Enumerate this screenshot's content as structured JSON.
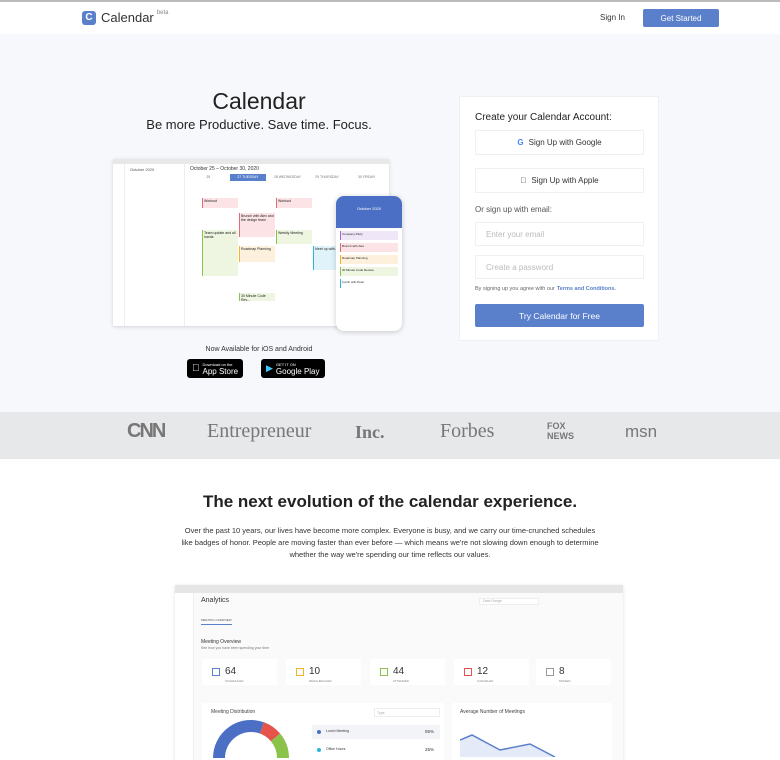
{
  "header": {
    "logo": "Calendar",
    "beta": "beta",
    "sign_in": "Sign In",
    "get_started": "Get Started"
  },
  "hero": {
    "title": "Calendar",
    "subtitle": "Be more Productive. Save time. Focus."
  },
  "mockup": {
    "range": "October 25 – October 30, 2020",
    "month": "October 2020",
    "tabs": [
      "25",
      "27 TUESDAY",
      "28 WEDNESDAY",
      "29 THURSDAY",
      "30 FRIDAY"
    ],
    "events": [
      "Workout",
      "Brunch with Alex and the design team",
      "Team update and all hands",
      "Weekly Meeting",
      "Roadmap Planning",
      "Meet up with...",
      "30 Minute Code Rev..."
    ],
    "phone_items": [
      "Company Party",
      "Brunch with Alex",
      "Roadmap Planning",
      "30 Minute Code Review",
      "Lunch with Peter"
    ]
  },
  "apps": {
    "available": "Now Available for iOS and Android",
    "appstore_small": "Download on the",
    "appstore": "App Store",
    "play_small": "GET IT ON",
    "play": "Google Play"
  },
  "signup": {
    "title": "Create your Calendar Account:",
    "google": "Sign Up with Google",
    "apple": "Sign Up with Apple",
    "or_email": "Or sign up with email:",
    "email_placeholder": "Enter your email",
    "password_placeholder": "Create a password",
    "terms_text": "By signing up you agree with our",
    "terms_link": "Terms and Conditions.",
    "submit": "Try Calendar for Free"
  },
  "press": [
    "CNN",
    "Entrepreneur",
    "Inc.",
    "Forbes",
    "FOX NEWS",
    "msn"
  ],
  "section": {
    "title": "The next evolution of the calendar experience.",
    "body": "Over the past 10 years, our lives have become more complex. Everyone is busy, and we carry our time-crunched schedules like badges of honor. People are moving faster than ever before — which means we're not slowing down enough to determine whether the way we're spending our time reflects our values."
  },
  "analytics": {
    "title": "Analytics",
    "tab": "MEETING OVERVIEW",
    "heading": "Meeting Overview",
    "subheading": "See how you have been spending your time",
    "date_range": "Date Range",
    "stats": [
      {
        "value": "64",
        "label": "SCHEDULED",
        "color": "#5a7fcb"
      },
      {
        "value": "10",
        "label": "RESCHEDULED",
        "color": "#f0b429"
      },
      {
        "value": "44",
        "label": "ATTENDED",
        "color": "#8bc34a"
      },
      {
        "value": "12",
        "label": "CANCELED",
        "color": "#e5534b"
      },
      {
        "value": "8",
        "label": "MISSED",
        "color": "#999999"
      }
    ],
    "distribution": "Meeting Distribution",
    "type": "Type",
    "avg": "Average Number of Meetings",
    "legend": [
      {
        "name": "Lunch Meeting",
        "pct": "55%",
        "color": "#4a6fc4"
      },
      {
        "name": "Office Hours",
        "pct": "25%",
        "color": "#29b6d9"
      }
    ]
  }
}
